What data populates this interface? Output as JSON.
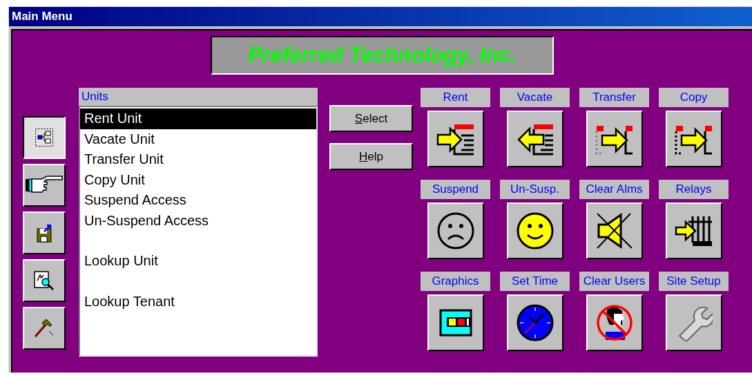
{
  "window": {
    "title": "Main Menu"
  },
  "banner": {
    "text": "Preferred Technology, Inc."
  },
  "toolbar": [
    {
      "kind": "tree",
      "selected": true
    },
    {
      "kind": "hand",
      "selected": false
    },
    {
      "kind": "floppy",
      "selected": false
    },
    {
      "kind": "inspect",
      "selected": false
    },
    {
      "kind": "hammer",
      "selected": false
    }
  ],
  "units_list": {
    "header": "Units",
    "items": [
      {
        "label": "Rent Unit",
        "selected": true,
        "spaced": false
      },
      {
        "label": "Vacate Unit",
        "selected": false,
        "spaced": false
      },
      {
        "label": "Transfer Unit",
        "selected": false,
        "spaced": false
      },
      {
        "label": "Copy Unit",
        "selected": false,
        "spaced": false
      },
      {
        "label": "Suspend Access",
        "selected": false,
        "spaced": false
      },
      {
        "label": "Un-Suspend Access",
        "selected": false,
        "spaced": false
      },
      {
        "label": "Lookup Unit",
        "selected": false,
        "spaced": true
      },
      {
        "label": "Lookup Tenant",
        "selected": false,
        "spaced": true
      }
    ]
  },
  "buttons": [
    {
      "mnemonic": "S",
      "rest": "elect"
    },
    {
      "mnemonic": "H",
      "rest": "elp"
    }
  ],
  "actions": [
    {
      "label": "Rent",
      "kind": "rent"
    },
    {
      "label": "Vacate",
      "kind": "vacate"
    },
    {
      "label": "Transfer",
      "kind": "transfer"
    },
    {
      "label": "Copy",
      "kind": "copy"
    },
    {
      "label": "Suspend",
      "kind": "sad"
    },
    {
      "label": "Un-Susp.",
      "kind": "smile"
    },
    {
      "label": "Clear Alms",
      "kind": "mute"
    },
    {
      "label": "Relays",
      "kind": "relay"
    },
    {
      "label": "Graphics",
      "kind": "graphics"
    },
    {
      "label": "Set Time",
      "kind": "clock"
    },
    {
      "label": "Clear Users",
      "kind": "nouser"
    },
    {
      "label": "Site Setup",
      "kind": "wrench"
    }
  ]
}
